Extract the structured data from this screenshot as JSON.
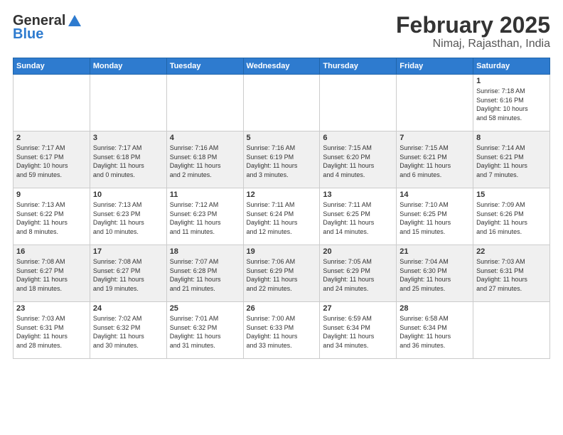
{
  "header": {
    "logo_general": "General",
    "logo_blue": "Blue",
    "month_title": "February 2025",
    "location": "Nimaj, Rajasthan, India"
  },
  "weekdays": [
    "Sunday",
    "Monday",
    "Tuesday",
    "Wednesday",
    "Thursday",
    "Friday",
    "Saturday"
  ],
  "weeks": [
    [
      {
        "day": "",
        "info": ""
      },
      {
        "day": "",
        "info": ""
      },
      {
        "day": "",
        "info": ""
      },
      {
        "day": "",
        "info": ""
      },
      {
        "day": "",
        "info": ""
      },
      {
        "day": "",
        "info": ""
      },
      {
        "day": "1",
        "info": "Sunrise: 7:18 AM\nSunset: 6:16 PM\nDaylight: 10 hours\nand 58 minutes."
      }
    ],
    [
      {
        "day": "2",
        "info": "Sunrise: 7:17 AM\nSunset: 6:17 PM\nDaylight: 10 hours\nand 59 minutes."
      },
      {
        "day": "3",
        "info": "Sunrise: 7:17 AM\nSunset: 6:18 PM\nDaylight: 11 hours\nand 0 minutes."
      },
      {
        "day": "4",
        "info": "Sunrise: 7:16 AM\nSunset: 6:18 PM\nDaylight: 11 hours\nand 2 minutes."
      },
      {
        "day": "5",
        "info": "Sunrise: 7:16 AM\nSunset: 6:19 PM\nDaylight: 11 hours\nand 3 minutes."
      },
      {
        "day": "6",
        "info": "Sunrise: 7:15 AM\nSunset: 6:20 PM\nDaylight: 11 hours\nand 4 minutes."
      },
      {
        "day": "7",
        "info": "Sunrise: 7:15 AM\nSunset: 6:21 PM\nDaylight: 11 hours\nand 6 minutes."
      },
      {
        "day": "8",
        "info": "Sunrise: 7:14 AM\nSunset: 6:21 PM\nDaylight: 11 hours\nand 7 minutes."
      }
    ],
    [
      {
        "day": "9",
        "info": "Sunrise: 7:13 AM\nSunset: 6:22 PM\nDaylight: 11 hours\nand 8 minutes."
      },
      {
        "day": "10",
        "info": "Sunrise: 7:13 AM\nSunset: 6:23 PM\nDaylight: 11 hours\nand 10 minutes."
      },
      {
        "day": "11",
        "info": "Sunrise: 7:12 AM\nSunset: 6:23 PM\nDaylight: 11 hours\nand 11 minutes."
      },
      {
        "day": "12",
        "info": "Sunrise: 7:11 AM\nSunset: 6:24 PM\nDaylight: 11 hours\nand 12 minutes."
      },
      {
        "day": "13",
        "info": "Sunrise: 7:11 AM\nSunset: 6:25 PM\nDaylight: 11 hours\nand 14 minutes."
      },
      {
        "day": "14",
        "info": "Sunrise: 7:10 AM\nSunset: 6:25 PM\nDaylight: 11 hours\nand 15 minutes."
      },
      {
        "day": "15",
        "info": "Sunrise: 7:09 AM\nSunset: 6:26 PM\nDaylight: 11 hours\nand 16 minutes."
      }
    ],
    [
      {
        "day": "16",
        "info": "Sunrise: 7:08 AM\nSunset: 6:27 PM\nDaylight: 11 hours\nand 18 minutes."
      },
      {
        "day": "17",
        "info": "Sunrise: 7:08 AM\nSunset: 6:27 PM\nDaylight: 11 hours\nand 19 minutes."
      },
      {
        "day": "18",
        "info": "Sunrise: 7:07 AM\nSunset: 6:28 PM\nDaylight: 11 hours\nand 21 minutes."
      },
      {
        "day": "19",
        "info": "Sunrise: 7:06 AM\nSunset: 6:29 PM\nDaylight: 11 hours\nand 22 minutes."
      },
      {
        "day": "20",
        "info": "Sunrise: 7:05 AM\nSunset: 6:29 PM\nDaylight: 11 hours\nand 24 minutes."
      },
      {
        "day": "21",
        "info": "Sunrise: 7:04 AM\nSunset: 6:30 PM\nDaylight: 11 hours\nand 25 minutes."
      },
      {
        "day": "22",
        "info": "Sunrise: 7:03 AM\nSunset: 6:31 PM\nDaylight: 11 hours\nand 27 minutes."
      }
    ],
    [
      {
        "day": "23",
        "info": "Sunrise: 7:03 AM\nSunset: 6:31 PM\nDaylight: 11 hours\nand 28 minutes."
      },
      {
        "day": "24",
        "info": "Sunrise: 7:02 AM\nSunset: 6:32 PM\nDaylight: 11 hours\nand 30 minutes."
      },
      {
        "day": "25",
        "info": "Sunrise: 7:01 AM\nSunset: 6:32 PM\nDaylight: 11 hours\nand 31 minutes."
      },
      {
        "day": "26",
        "info": "Sunrise: 7:00 AM\nSunset: 6:33 PM\nDaylight: 11 hours\nand 33 minutes."
      },
      {
        "day": "27",
        "info": "Sunrise: 6:59 AM\nSunset: 6:34 PM\nDaylight: 11 hours\nand 34 minutes."
      },
      {
        "day": "28",
        "info": "Sunrise: 6:58 AM\nSunset: 6:34 PM\nDaylight: 11 hours\nand 36 minutes."
      },
      {
        "day": "",
        "info": ""
      }
    ]
  ]
}
